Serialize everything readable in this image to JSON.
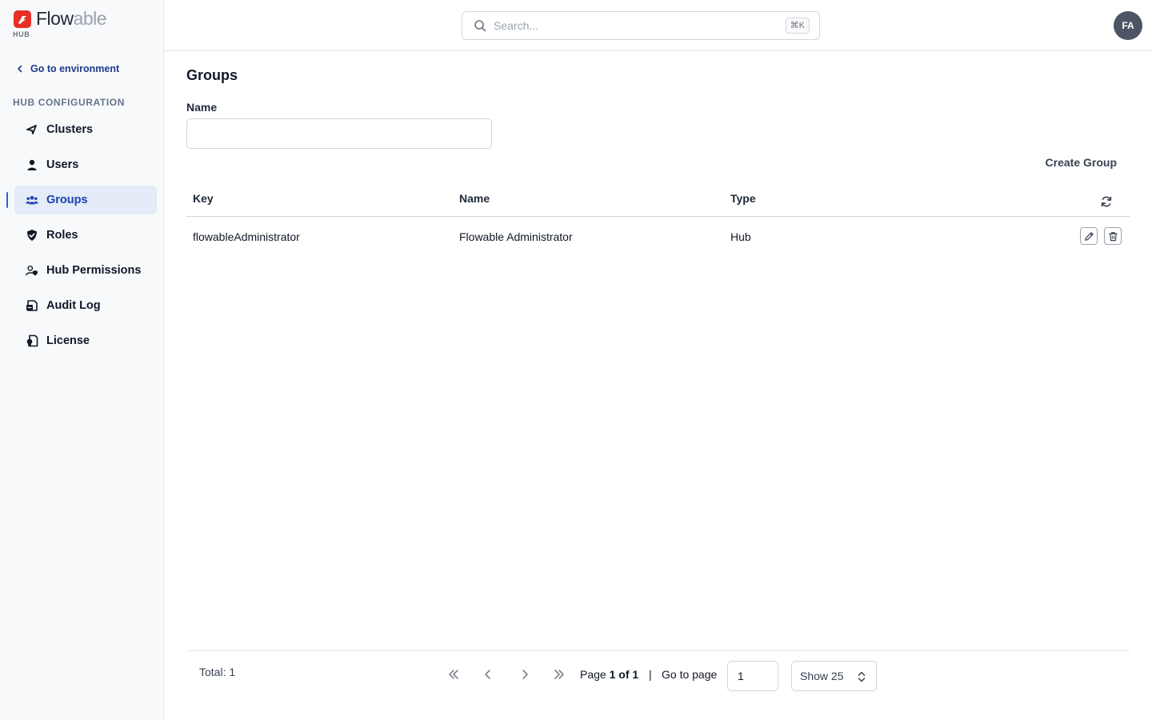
{
  "brand": {
    "word_main": "Flow",
    "word_accent": "able",
    "sub": "HUB"
  },
  "sidebar": {
    "back_label": "Go to environment",
    "section_title": "HUB CONFIGURATION",
    "items": [
      {
        "label": "Clusters",
        "icon": "clusters-icon"
      },
      {
        "label": "Users",
        "icon": "user-icon"
      },
      {
        "label": "Groups",
        "icon": "groups-icon",
        "active": true
      },
      {
        "label": "Roles",
        "icon": "shield-icon"
      },
      {
        "label": "Hub Permissions",
        "icon": "user-permissions-icon"
      },
      {
        "label": "Audit Log",
        "icon": "audit-log-icon"
      },
      {
        "label": "License",
        "icon": "license-icon"
      }
    ]
  },
  "header": {
    "search_placeholder": "Search...",
    "search_shortcut": "⌘K",
    "avatar_initials": "FA"
  },
  "main": {
    "title": "Groups",
    "filter_label": "Name",
    "filter_value": "",
    "create_label": "Create Group",
    "columns": [
      "Key",
      "Name",
      "Type"
    ],
    "rows": [
      {
        "key": "flowableAdministrator",
        "name": "Flowable Administrator",
        "type": "Hub"
      }
    ]
  },
  "pagination": {
    "total_label": "Total: 1",
    "page_prefix": "Page",
    "page_current": "1 of 1",
    "separator": "|",
    "goto_label": "Go to page",
    "goto_value": "1",
    "show_label": "Show 25"
  },
  "colors": {
    "brand_red": "#e63027",
    "accent": "#1e40af",
    "active_bg": "#e3ecf7"
  }
}
